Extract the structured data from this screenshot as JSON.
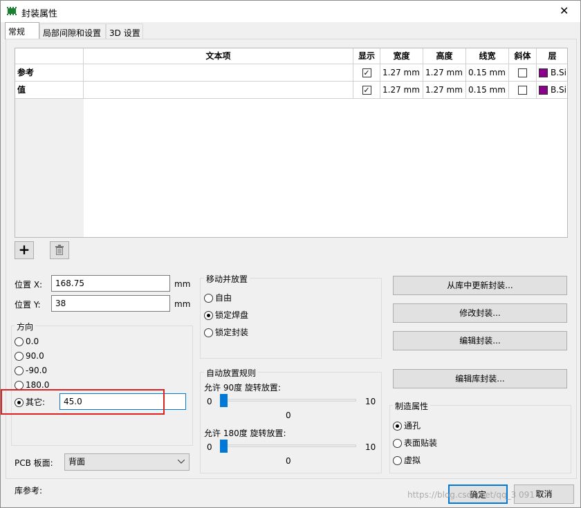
{
  "window": {
    "title": "封装属性",
    "close_glyph": "✕"
  },
  "tabs": [
    "常规",
    "局部间隙和设置",
    "3D 设置"
  ],
  "text_table": {
    "headers": [
      "文本项",
      "显示",
      "宽度",
      "高度",
      "线宽",
      "斜体",
      "层"
    ],
    "rows": [
      {
        "label": "参考",
        "text": "",
        "show": true,
        "width": "1.27 mm",
        "height": "1.27 mm",
        "thickness": "0.15 mm",
        "italic": false,
        "layer": "B.Si",
        "layer_color": "#8b008b"
      },
      {
        "label": "值",
        "text": "",
        "show": true,
        "width": "1.27 mm",
        "height": "1.27 mm",
        "thickness": "0.15 mm",
        "italic": false,
        "layer": "B.Si",
        "layer_color": "#8b008b"
      }
    ],
    "add_glyph": "+",
    "delete_icon": "trash-icon"
  },
  "position": {
    "x_label": "位置 X:",
    "x_value": "168.75",
    "x_unit": "mm",
    "y_label": "位置 Y:",
    "y_value": "38",
    "y_unit": "mm"
  },
  "orientation": {
    "title": "方向",
    "options": [
      "0.0",
      "90.0",
      "-90.0",
      "180.0"
    ],
    "other_label": "其它:",
    "other_value": "45.0",
    "selected": "其它:"
  },
  "board_side": {
    "label": "PCB 板面:",
    "value": "背面"
  },
  "move_place": {
    "title": "移动并放置",
    "options": [
      "自由",
      "锁定焊盘",
      "锁定封装"
    ],
    "selected": "锁定焊盘"
  },
  "auto_place": {
    "title": "自动放置规则",
    "rot90": {
      "label": "允许 90度 旋转放置:",
      "min": "0",
      "max": "10",
      "value": "0"
    },
    "rot180": {
      "label": "允许 180度 旋转放置:",
      "min": "0",
      "max": "10",
      "value": "0"
    }
  },
  "actions": {
    "update_from_lib": "从库中更新封装...",
    "change_fp": "修改封装...",
    "edit_fp": "编辑封装...",
    "edit_lib_fp": "编辑库封装..."
  },
  "fabrication": {
    "title": "制造属性",
    "options": [
      "通孔",
      "表面贴装",
      "虚拟"
    ],
    "selected": "通孔"
  },
  "footer": {
    "lib_ref_label": "库参考:",
    "ok": "确定",
    "cancel": "取消",
    "watermark": "https://blog.csdn.net/qq_3    091"
  },
  "colors": {
    "accent": "#0078d7",
    "highlight_box": "#e02020",
    "layer": "#8b008b"
  }
}
